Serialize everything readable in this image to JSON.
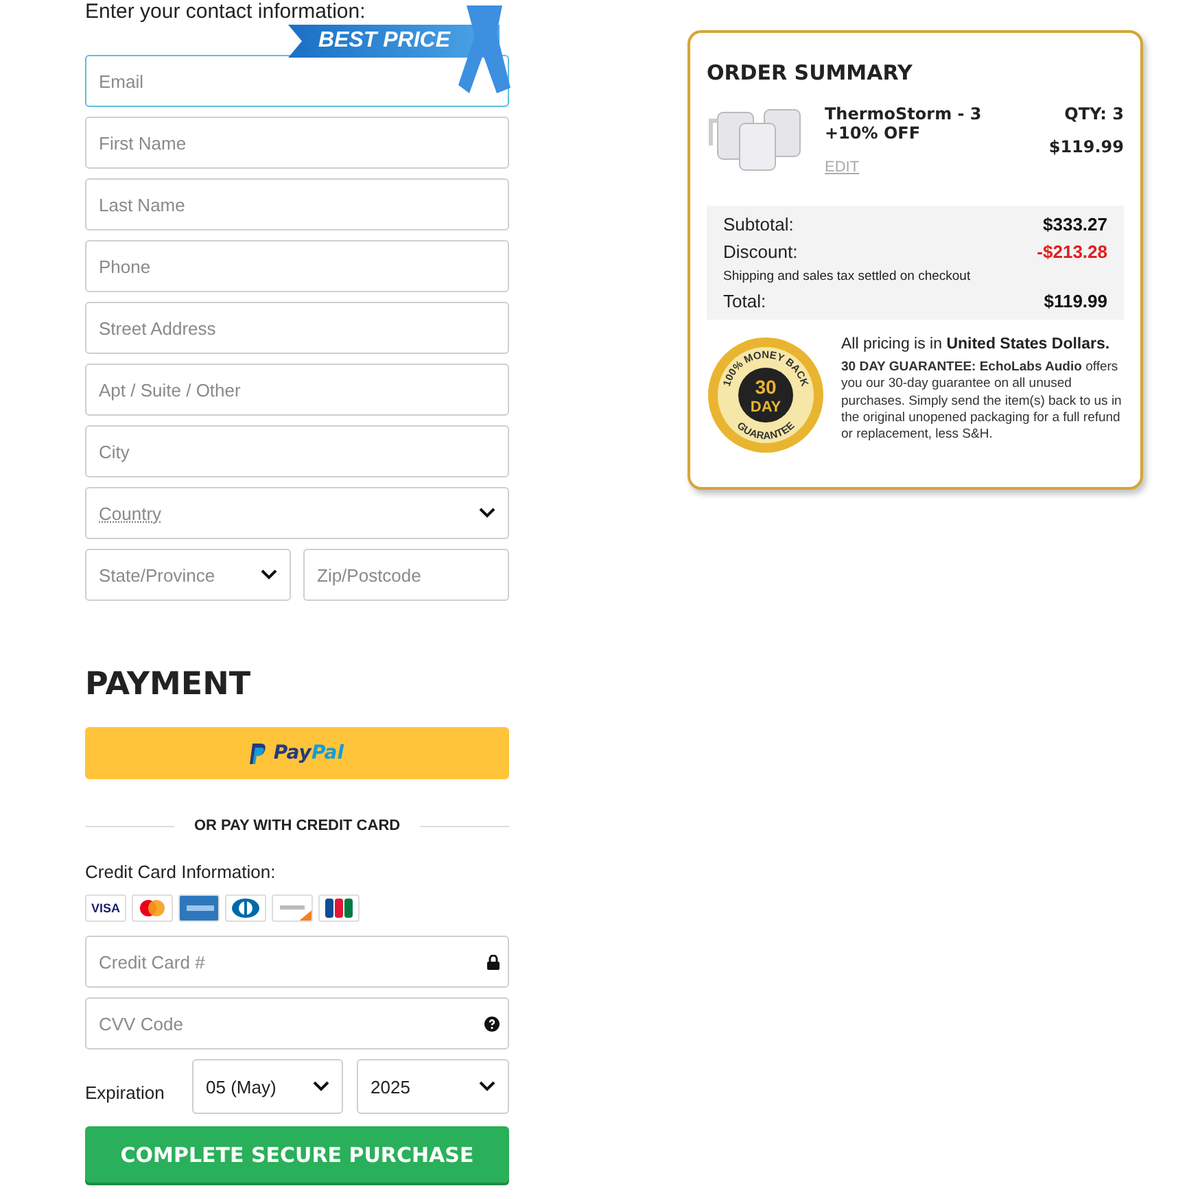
{
  "contact": {
    "heading": "Enter your contact information:",
    "badge": "BEST PRICE",
    "fields": [
      {
        "kind": "input",
        "placeholder": "Email",
        "focused": true
      },
      {
        "kind": "input",
        "placeholder": "First Name",
        "focused": false
      },
      {
        "kind": "input",
        "placeholder": "Last Name",
        "focused": false
      },
      {
        "kind": "input",
        "placeholder": "Phone",
        "focused": false
      },
      {
        "kind": "input",
        "placeholder": "Street Address",
        "focused": false
      },
      {
        "kind": "input",
        "placeholder": "Apt / Suite / Other",
        "focused": false
      },
      {
        "kind": "input",
        "placeholder": "City",
        "focused": false
      },
      {
        "kind": "select",
        "placeholder": "Country",
        "focused": false
      }
    ],
    "state": {
      "placeholder": "State/Province"
    },
    "zip": {
      "placeholder": "Zip/Postcode"
    }
  },
  "payment": {
    "heading": "PAYMENT",
    "paypal": [
      "Pay",
      "Pal"
    ],
    "divider": "OR PAY WITH CREDIT CARD",
    "card_info_label": "Credit Card Information:",
    "cards": [
      {
        "kind": "visa",
        "label": "VISA"
      },
      {
        "kind": "mastercard"
      },
      {
        "kind": "amex"
      },
      {
        "kind": "diners"
      },
      {
        "kind": "discover"
      },
      {
        "kind": "jcb"
      }
    ],
    "card_number": {
      "placeholder": "Credit Card #"
    },
    "cvv": {
      "placeholder": "CVV Code"
    },
    "expiration": {
      "label": "Expiration",
      "month": "05 (May)",
      "year": "2025"
    },
    "submit": "COMPLETE SECURE PURCHASE"
  },
  "order_summary": {
    "title": "ORDER SUMMARY",
    "product": {
      "name": "ThermoStorm - 3 +10% OFF",
      "edit": "EDIT",
      "qty": "QTY: 3",
      "price": "$119.99"
    },
    "lines": [
      {
        "kind": "amount",
        "label": "Subtotal:",
        "value": "$333.27"
      },
      {
        "kind": "discount",
        "label": "Discount:",
        "value": "-$213.28"
      },
      {
        "kind": "note",
        "label": "Shipping and sales tax settled on checkout"
      },
      {
        "kind": "amount",
        "label": "Total:",
        "value": "$119.99"
      }
    ],
    "seal": {
      "arc_top": "100% MONEY BACK",
      "number": "30",
      "unit": "DAY",
      "arc_bottom": "GUARANTEE"
    },
    "currency_note": "All pricing is in **United States Dollars.**",
    "guarantee": "**30 DAY GUARANTEE: EchoLabs Audio** offers you our 30-day guarantee on all unused purchases. Simply send the item(s) back to us in the original unopened packaging for a full refund or replacement, less S&H."
  }
}
